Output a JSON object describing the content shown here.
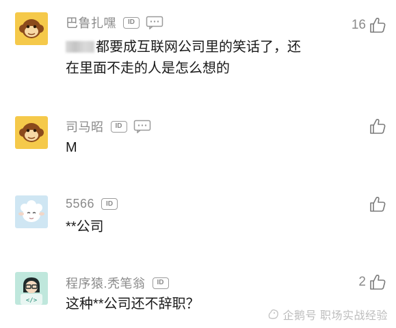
{
  "comments": [
    {
      "username": "巴鲁扎嘿",
      "id_badge": "ID",
      "text_lines": [
        "都要成互联网公司里的笑话了，还",
        "在里面不走的人是怎么想的"
      ],
      "likes": "16",
      "avatar_icon": "monkey-icon"
    },
    {
      "username": "司马昭",
      "id_badge": "ID",
      "text_lines": [
        "M"
      ],
      "likes": "",
      "avatar_icon": "monkey-icon"
    },
    {
      "username": "5566",
      "id_badge": "ID",
      "text_lines": [
        "**公司"
      ],
      "likes": "",
      "avatar_icon": "sheep-icon"
    },
    {
      "username": "程序猿.秃笔翁",
      "id_badge": "ID",
      "text_lines": [
        "这种**公司还不辞职？"
      ],
      "likes": "2",
      "avatar_icon": "programmer-icon"
    }
  ],
  "watermark": {
    "text": "企鹅号 职场实战经验",
    "icon": "penguin-icon"
  },
  "colors": {
    "username": "#8a8a8a",
    "text": "#1a1a1a",
    "monkey_avatar_bg": "#f5c94a",
    "sheep_avatar_bg": "#cfe6f3",
    "programmer_avatar_bg": "#bfe7dc"
  }
}
